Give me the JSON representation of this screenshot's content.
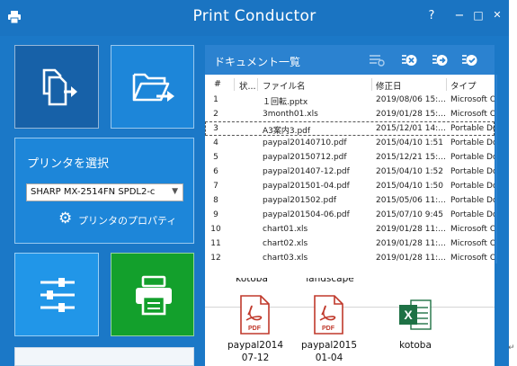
{
  "window": {
    "title": "Print Conductor"
  },
  "titlebar": {
    "help": "?",
    "minimize": "−",
    "maximize": "□",
    "close": "✕"
  },
  "colors": {
    "brand_blue": "#1b78c7",
    "tile_dark": "#1761a8",
    "tile_blue": "#1d86d9",
    "tile_green": "#13a02c"
  },
  "tiles": {
    "add_documents": "add-documents-icon",
    "add_folder": "add-folder-icon",
    "settings": "sliders-icon",
    "print": "printer-icon"
  },
  "printer": {
    "label": "プリンタを選択",
    "selected": "SHARP MX-2514FN SPDL2-c",
    "properties_label": "プリンタのプロパティ"
  },
  "documents": {
    "title": "ドキュメント一覧",
    "columns": {
      "num": "#",
      "state": "状...",
      "name": "ファイル名",
      "date": "修正日",
      "type": "タイプ"
    },
    "rows": [
      {
        "num": "1",
        "name": "１回転.pptx",
        "date": "2019/08/06 15:...",
        "type": "Microsoft O"
      },
      {
        "num": "2",
        "name": "3month01.xls",
        "date": "2019/01/28 15:...",
        "type": "Microsoft O"
      },
      {
        "num": "3",
        "name": "A3案内3.pdf",
        "date": "2015/12/01 14:...",
        "type": "Portable Do"
      },
      {
        "num": "4",
        "name": "paypal20140710.pdf",
        "date": "2015/04/10 1:51",
        "type": "Portable Do"
      },
      {
        "num": "5",
        "name": "paypal20150712.pdf",
        "date": "2015/12/21 15:...",
        "type": "Portable Do"
      },
      {
        "num": "6",
        "name": "paypal201407-12.pdf",
        "date": "2015/04/10 1:52",
        "type": "Portable Do"
      },
      {
        "num": "7",
        "name": "paypal201501-04.pdf",
        "date": "2015/04/10 1:50",
        "type": "Portable Do"
      },
      {
        "num": "8",
        "name": "paypal201502.pdf",
        "date": "2015/05/06 11:...",
        "type": "Portable Do"
      },
      {
        "num": "9",
        "name": "paypal201504-06.pdf",
        "date": "2015/07/10 9:45",
        "type": "Portable Do"
      },
      {
        "num": "10",
        "name": "chart01.xls",
        "date": "2019/01/28 11:...",
        "type": "Microsoft O"
      },
      {
        "num": "11",
        "name": "chart02.xls",
        "date": "2019/01/28 11:...",
        "type": "Microsoft O"
      },
      {
        "num": "12",
        "name": "chart03.xls",
        "date": "2019/01/28 11:...",
        "type": "Microsoft O"
      }
    ],
    "selected_row": 3
  },
  "thumbnails": {
    "partial_top": [
      "kotoba",
      "landscape"
    ],
    "items": [
      {
        "line1": "paypal2014",
        "line2": "07-12",
        "icon": "pdf-file-icon",
        "badge": "PDF"
      },
      {
        "line1": "paypal2015",
        "line2": "01-04",
        "icon": "pdf-file-icon",
        "badge": "PDF"
      },
      {
        "line1": "kotoba",
        "line2": "",
        "icon": "excel-file-icon",
        "badge": "X"
      }
    ]
  },
  "corner_mark": "↵"
}
